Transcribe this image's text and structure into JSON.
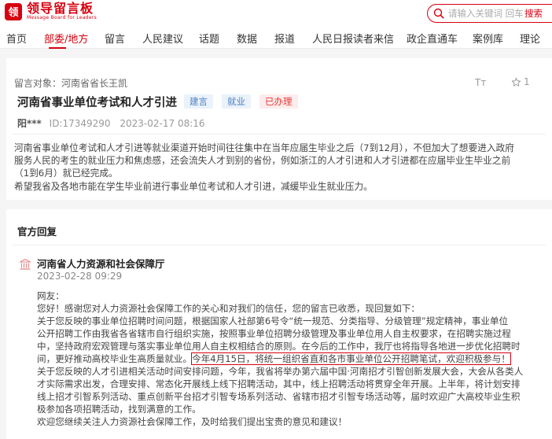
{
  "header": {
    "logo_mark": "领",
    "logo_cn": "领导留言板",
    "logo_en": "Message Board for Leaders",
    "search_placeholder": "请输入关键词 回车",
    "search_button": "搜索"
  },
  "nav": {
    "items": [
      "首页",
      "部委/地方",
      "留言",
      "人民建议",
      "话题",
      "数据",
      "报道",
      "人民日报读者来信",
      "政企直通车",
      "案例库",
      "理论"
    ],
    "active_index": 1
  },
  "message": {
    "target": "留言对象：河南省省长王凯",
    "title": "河南省事业单位考试和人才引进",
    "tags": [
      "建言",
      "就业",
      "已办理"
    ],
    "author": "阳***",
    "id": "ID:17349290",
    "date": "2023-02-17 08:16",
    "font_icon": "Tт",
    "star_count": "1",
    "body_lines": [
      "河南省事业单位考试和人才引进等就业渠道开始时间往往集中在当年应届生毕业之后（7到12月），不但加大了想要进入政府",
      "服务人民的考生的就业压力和焦虑感，还会流失人才到别的省份，例如浙江的人才引进和人才引进都在应届毕业生毕业之前",
      "（1到6月）就已经完成。",
      "希望我省及各地市能在学生毕业前进行事业单位考试和人才引进，减缓毕业生就业压力。"
    ]
  },
  "reply": {
    "section_title": "官方回复",
    "org": "河南省人力资源和社会保障厅",
    "date": "2023-02-28 09:29",
    "lines": [
      "网友：",
      "您好！感谢您对人力资源社会保障工作的关心和对我们的信任，您的留言已收悉，现回复如下：",
      "关于您反映的事业单位招聘时间问题，根据国家人社部第6号令“统一规范、分类指导、分级管理”规定精神，事业单位",
      "公开招聘工作由我省各省辖市自行组织实施，按照事业单位招聘分级管理及事业单位用人自主权要求，在招聘实施过程",
      "中，坚持政府宏观管理与落实事业单位用人自主权相结合的原则。在今后的工作中，我厅也将指导各地进一步优化招聘时",
      "间，更好推动高校毕业生高质量就业。",
      "关于您反映的人才引进相关活动时间安排问题，今年，我省将举办第六届中国·河南招才引智创新发展大会，大会从各类人",
      "才实际需求出发，合理安排、常态化开展线上线下招聘活动，其中，线上招聘活动将贯穿全年开展。上半年，将计划安排",
      "线上招才引智系列活动、重点创新平台招才引智专场系列活动、省辖市招才引智专场活动等，届时欢迎广大高校毕业生积",
      "极参加各项招聘活动，找到满意的工作。",
      "欢迎您继续关注人力资源社会保障工作，及时给我们提出宝贵的意见和建议！"
    ],
    "highlight": "今年4月15日，将统一组织省直和各市事业单位公开招聘笔试，欢迎积极参与！"
  }
}
